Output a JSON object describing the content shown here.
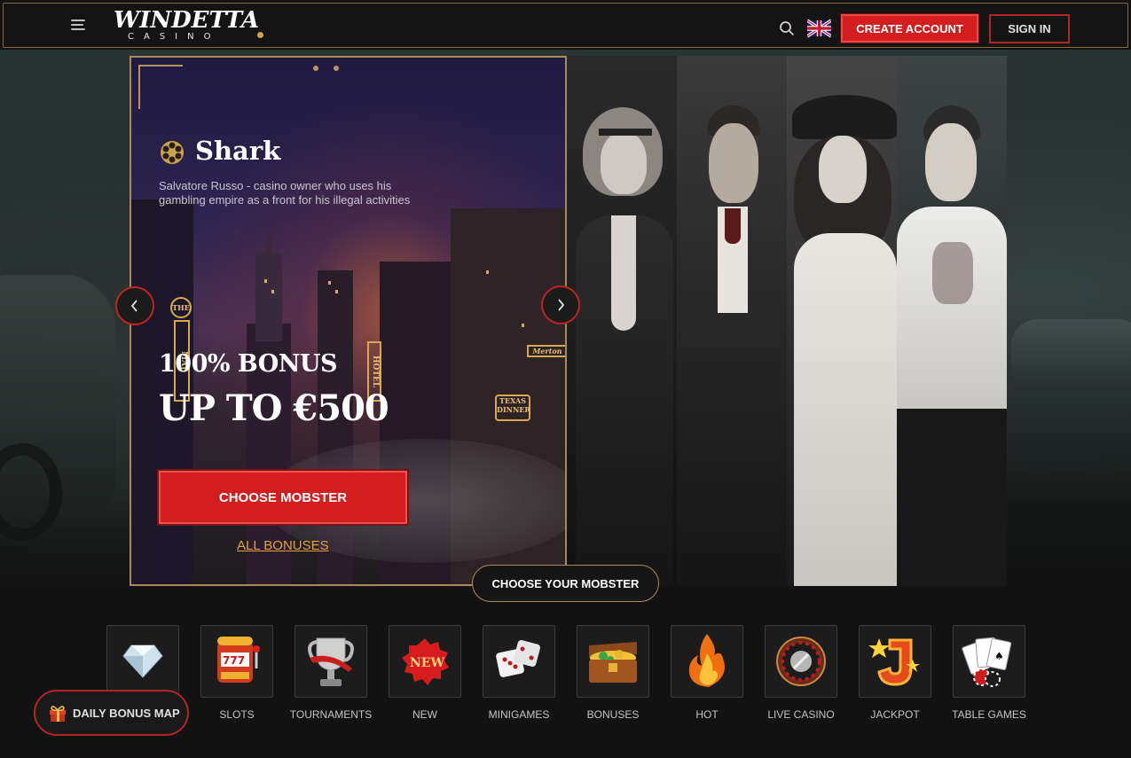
{
  "header": {
    "logo_main": "WINDETTA",
    "logo_sub": "CASINO",
    "create_account": "CREATE ACCOUNT",
    "sign_in": "SIGN IN"
  },
  "hero": {
    "mobster_name": "Shark",
    "mobster_desc": "Salvatore Russo - casino owner who uses his gambling empire as a front for his illegal activities",
    "bonus_line1": "100% BONUS",
    "bonus_line2": "UP TO €500",
    "choose_button": "CHOOSE MOBSTER",
    "all_bonuses": "ALL BONUSES",
    "choose_your": "CHOOSE YOUR MOBSTER",
    "signs": [
      "THE",
      "MAJ",
      "HOTEL",
      "TEXAS DINNER",
      "Merton"
    ]
  },
  "categories": [
    {
      "label": "",
      "icon": "diamond-icon"
    },
    {
      "label": "SLOTS",
      "icon": "slot-machine-icon"
    },
    {
      "label": "TOURNAMENTS",
      "icon": "trophy-icon"
    },
    {
      "label": "NEW",
      "icon": "new-badge-icon"
    },
    {
      "label": "MINIGAMES",
      "icon": "dice-icon"
    },
    {
      "label": "BONUSES",
      "icon": "treasure-chest-icon"
    },
    {
      "label": "HOT",
      "icon": "flame-icon"
    },
    {
      "label": "LIVE CASINO",
      "icon": "roulette-icon"
    },
    {
      "label": "JACKPOT",
      "icon": "jackpot-icon"
    },
    {
      "label": "TABLE GAMES",
      "icon": "cards-icon"
    }
  ],
  "daily_bonus": "DAILY BONUS MAP",
  "colors": {
    "accent_red": "#d21e1e",
    "gold": "#a88a5a",
    "link_orange": "#e5a23c",
    "background": "#121212"
  }
}
